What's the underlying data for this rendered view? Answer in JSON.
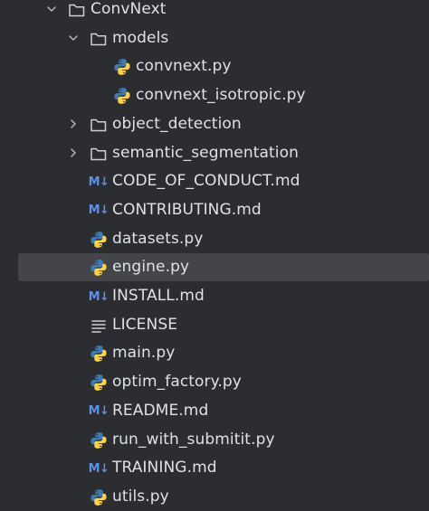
{
  "project_tree": {
    "items": [
      {
        "label": "ConvNext",
        "type": "folder",
        "depth": 0,
        "expanded": true
      },
      {
        "label": "models",
        "type": "folder",
        "depth": 1,
        "expanded": true
      },
      {
        "label": "convnext.py",
        "type": "python",
        "depth": 2
      },
      {
        "label": "convnext_isotropic.py",
        "type": "python",
        "depth": 2
      },
      {
        "label": "object_detection",
        "type": "folder",
        "depth": 1,
        "expanded": false
      },
      {
        "label": "semantic_segmentation",
        "type": "folder",
        "depth": 1,
        "expanded": false
      },
      {
        "label": "CODE_OF_CONDUCT.md",
        "type": "markdown",
        "depth": 1
      },
      {
        "label": "CONTRIBUTING.md",
        "type": "markdown",
        "depth": 1
      },
      {
        "label": "datasets.py",
        "type": "python",
        "depth": 1
      },
      {
        "label": "engine.py",
        "type": "python",
        "depth": 1,
        "selected": true
      },
      {
        "label": "INSTALL.md",
        "type": "markdown",
        "depth": 1
      },
      {
        "label": "LICENSE",
        "type": "text",
        "depth": 1
      },
      {
        "label": "main.py",
        "type": "python",
        "depth": 1
      },
      {
        "label": "optim_factory.py",
        "type": "python",
        "depth": 1
      },
      {
        "label": "README.md",
        "type": "markdown",
        "depth": 1
      },
      {
        "label": "run_with_submitit.py",
        "type": "python",
        "depth": 1
      },
      {
        "label": "TRAINING.md",
        "type": "markdown",
        "depth": 1
      },
      {
        "label": "utils.py",
        "type": "python",
        "depth": 1
      }
    ]
  },
  "icons": {
    "folder": "folder-icon",
    "python": "python-file-icon",
    "markdown": "markdown-file-icon",
    "text": "text-file-icon",
    "expanded": "chevron-down-icon",
    "collapsed": "chevron-right-icon",
    "markdown_glyph": "M↓"
  },
  "colors": {
    "background": "#2b2d30",
    "selection": "#43454a",
    "text": "#dfe1e5",
    "folder_stroke": "#ced0d6",
    "python_blue": "#3d7ab8",
    "python_yellow": "#ffd23f",
    "markdown_blue": "#5a8ff0"
  }
}
